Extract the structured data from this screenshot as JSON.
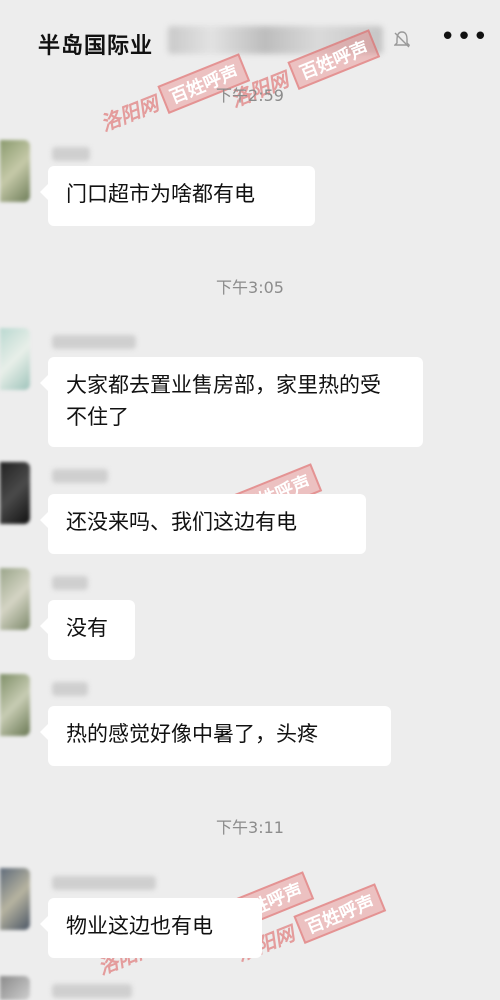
{
  "header": {
    "title": "半岛国际业",
    "more_icon": "more-dots-icon",
    "mute_icon": "bell-mute-icon"
  },
  "timestamps": [
    "下午2:59",
    "下午3:05",
    "下午3:11"
  ],
  "messages": [
    {
      "text": "门口超市为啥都有电"
    },
    {
      "text": "大家都去置业售房部，家里热的受不住了"
    },
    {
      "text": "还没来吗、我们这边有电"
    },
    {
      "text": "没有"
    },
    {
      "text": "热的感觉好像中暑了，头疼"
    },
    {
      "text": "物业这边也有电"
    }
  ],
  "watermark": {
    "part1": "洛阳网",
    "part2": "百姓呼声"
  }
}
